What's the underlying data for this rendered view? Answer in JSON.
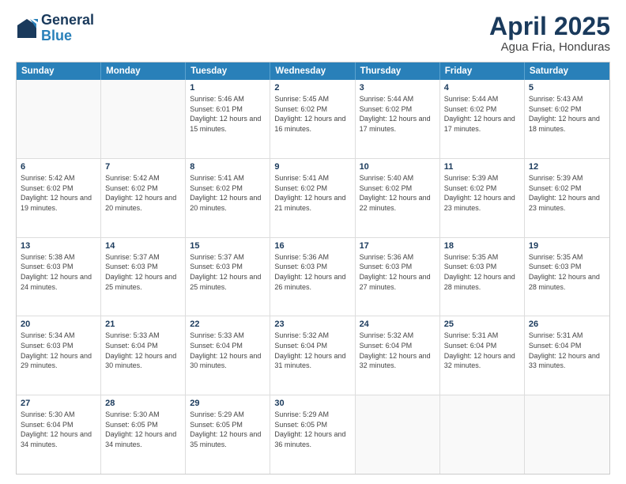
{
  "logo": {
    "line1": "General",
    "line2": "Blue"
  },
  "title": "April 2025",
  "subtitle": "Agua Fria, Honduras",
  "header_days": [
    "Sunday",
    "Monday",
    "Tuesday",
    "Wednesday",
    "Thursday",
    "Friday",
    "Saturday"
  ],
  "weeks": [
    [
      {
        "day": "",
        "info": ""
      },
      {
        "day": "",
        "info": ""
      },
      {
        "day": "1",
        "info": "Sunrise: 5:46 AM\nSunset: 6:01 PM\nDaylight: 12 hours and 15 minutes."
      },
      {
        "day": "2",
        "info": "Sunrise: 5:45 AM\nSunset: 6:02 PM\nDaylight: 12 hours and 16 minutes."
      },
      {
        "day": "3",
        "info": "Sunrise: 5:44 AM\nSunset: 6:02 PM\nDaylight: 12 hours and 17 minutes."
      },
      {
        "day": "4",
        "info": "Sunrise: 5:44 AM\nSunset: 6:02 PM\nDaylight: 12 hours and 17 minutes."
      },
      {
        "day": "5",
        "info": "Sunrise: 5:43 AM\nSunset: 6:02 PM\nDaylight: 12 hours and 18 minutes."
      }
    ],
    [
      {
        "day": "6",
        "info": "Sunrise: 5:42 AM\nSunset: 6:02 PM\nDaylight: 12 hours and 19 minutes."
      },
      {
        "day": "7",
        "info": "Sunrise: 5:42 AM\nSunset: 6:02 PM\nDaylight: 12 hours and 20 minutes."
      },
      {
        "day": "8",
        "info": "Sunrise: 5:41 AM\nSunset: 6:02 PM\nDaylight: 12 hours and 20 minutes."
      },
      {
        "day": "9",
        "info": "Sunrise: 5:41 AM\nSunset: 6:02 PM\nDaylight: 12 hours and 21 minutes."
      },
      {
        "day": "10",
        "info": "Sunrise: 5:40 AM\nSunset: 6:02 PM\nDaylight: 12 hours and 22 minutes."
      },
      {
        "day": "11",
        "info": "Sunrise: 5:39 AM\nSunset: 6:02 PM\nDaylight: 12 hours and 23 minutes."
      },
      {
        "day": "12",
        "info": "Sunrise: 5:39 AM\nSunset: 6:02 PM\nDaylight: 12 hours and 23 minutes."
      }
    ],
    [
      {
        "day": "13",
        "info": "Sunrise: 5:38 AM\nSunset: 6:03 PM\nDaylight: 12 hours and 24 minutes."
      },
      {
        "day": "14",
        "info": "Sunrise: 5:37 AM\nSunset: 6:03 PM\nDaylight: 12 hours and 25 minutes."
      },
      {
        "day": "15",
        "info": "Sunrise: 5:37 AM\nSunset: 6:03 PM\nDaylight: 12 hours and 25 minutes."
      },
      {
        "day": "16",
        "info": "Sunrise: 5:36 AM\nSunset: 6:03 PM\nDaylight: 12 hours and 26 minutes."
      },
      {
        "day": "17",
        "info": "Sunrise: 5:36 AM\nSunset: 6:03 PM\nDaylight: 12 hours and 27 minutes."
      },
      {
        "day": "18",
        "info": "Sunrise: 5:35 AM\nSunset: 6:03 PM\nDaylight: 12 hours and 28 minutes."
      },
      {
        "day": "19",
        "info": "Sunrise: 5:35 AM\nSunset: 6:03 PM\nDaylight: 12 hours and 28 minutes."
      }
    ],
    [
      {
        "day": "20",
        "info": "Sunrise: 5:34 AM\nSunset: 6:03 PM\nDaylight: 12 hours and 29 minutes."
      },
      {
        "day": "21",
        "info": "Sunrise: 5:33 AM\nSunset: 6:04 PM\nDaylight: 12 hours and 30 minutes."
      },
      {
        "day": "22",
        "info": "Sunrise: 5:33 AM\nSunset: 6:04 PM\nDaylight: 12 hours and 30 minutes."
      },
      {
        "day": "23",
        "info": "Sunrise: 5:32 AM\nSunset: 6:04 PM\nDaylight: 12 hours and 31 minutes."
      },
      {
        "day": "24",
        "info": "Sunrise: 5:32 AM\nSunset: 6:04 PM\nDaylight: 12 hours and 32 minutes."
      },
      {
        "day": "25",
        "info": "Sunrise: 5:31 AM\nSunset: 6:04 PM\nDaylight: 12 hours and 32 minutes."
      },
      {
        "day": "26",
        "info": "Sunrise: 5:31 AM\nSunset: 6:04 PM\nDaylight: 12 hours and 33 minutes."
      }
    ],
    [
      {
        "day": "27",
        "info": "Sunrise: 5:30 AM\nSunset: 6:04 PM\nDaylight: 12 hours and 34 minutes."
      },
      {
        "day": "28",
        "info": "Sunrise: 5:30 AM\nSunset: 6:05 PM\nDaylight: 12 hours and 34 minutes."
      },
      {
        "day": "29",
        "info": "Sunrise: 5:29 AM\nSunset: 6:05 PM\nDaylight: 12 hours and 35 minutes."
      },
      {
        "day": "30",
        "info": "Sunrise: 5:29 AM\nSunset: 6:05 PM\nDaylight: 12 hours and 36 minutes."
      },
      {
        "day": "",
        "info": ""
      },
      {
        "day": "",
        "info": ""
      },
      {
        "day": "",
        "info": ""
      }
    ]
  ]
}
